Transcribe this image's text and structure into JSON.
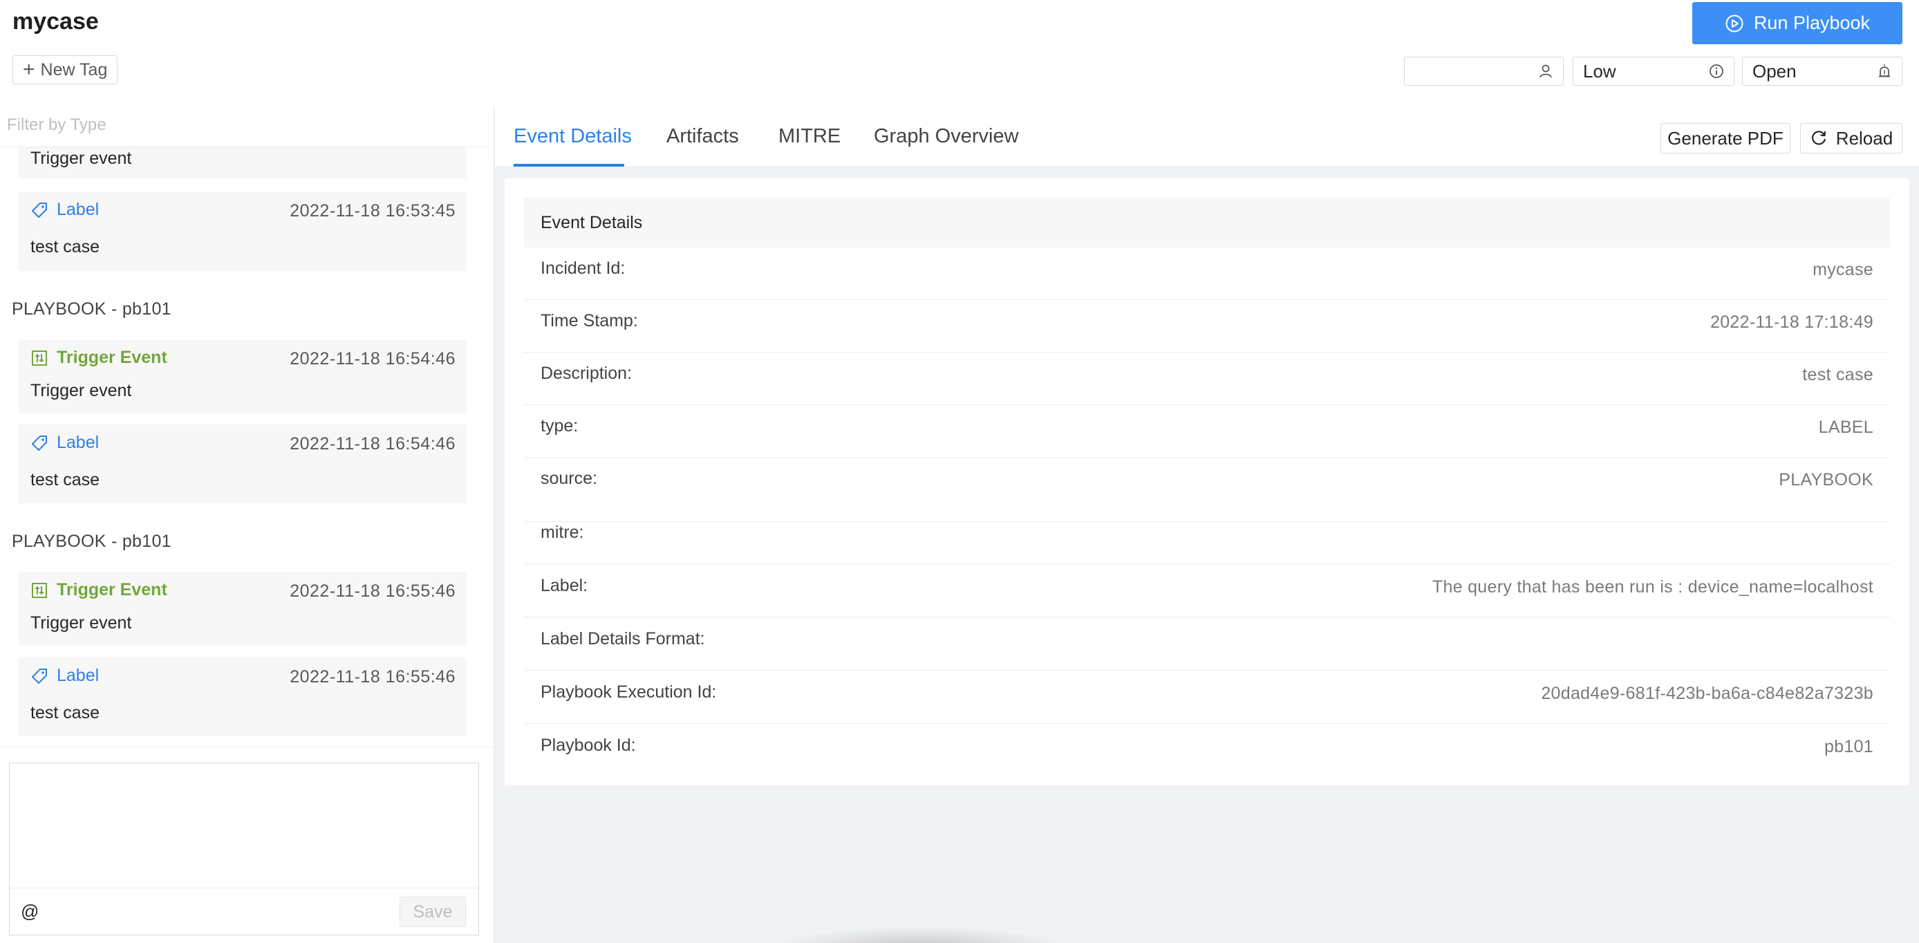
{
  "header": {
    "case_title": "mycase",
    "new_tag_label": "New Tag",
    "run_playbook_label": "Run Playbook",
    "assignee_value": "",
    "severity_value": "Low",
    "status_value": "Open"
  },
  "colors": {
    "accent": "#3d8ff5",
    "label_blue": "#2f80e6",
    "trigger_green": "#73a63c"
  },
  "timeline": {
    "filter_placeholder": "Filter by Type",
    "partial_card_desc": "Trigger event",
    "cards": [
      {
        "kind": "label",
        "title": "Label",
        "time": "2022-11-18 16:53:45",
        "desc": "test case",
        "icon": "tag-icon"
      }
    ],
    "groups": [
      {
        "title": "PLAYBOOK - pb101",
        "cards": [
          {
            "kind": "trigger",
            "title": "Trigger Event",
            "time": "2022-11-18 16:54:46",
            "desc": "Trigger event",
            "icon": "trigger-icon"
          },
          {
            "kind": "label",
            "title": "Label",
            "time": "2022-11-18 16:54:46",
            "desc": "test case",
            "icon": "tag-icon"
          }
        ]
      },
      {
        "title": "PLAYBOOK - pb101",
        "cards": [
          {
            "kind": "trigger",
            "title": "Trigger Event",
            "time": "2022-11-18 16:55:46",
            "desc": "Trigger event",
            "icon": "trigger-icon"
          },
          {
            "kind": "label",
            "title": "Label",
            "time": "2022-11-18 16:55:46",
            "desc": "test case",
            "icon": "tag-icon"
          }
        ]
      }
    ]
  },
  "comment": {
    "text": "",
    "mention_symbol": "@",
    "save_label": "Save"
  },
  "tabs": [
    "Event Details",
    "Artifacts",
    "MITRE",
    "Graph Overview"
  ],
  "actions": {
    "generate_pdf": "Generate PDF",
    "reload": "Reload"
  },
  "event_details": {
    "heading": "Event Details",
    "rows": [
      {
        "key": "Incident Id:",
        "value": "mycase"
      },
      {
        "key": "Time Stamp:",
        "value": "2022-11-18 17:18:49"
      },
      {
        "key": "Description:",
        "value": "test case"
      },
      {
        "key": "type:",
        "value": "LABEL"
      },
      {
        "key": "source:",
        "value": "PLAYBOOK"
      },
      {
        "key": "mitre:",
        "value": ""
      },
      {
        "key": "Label:",
        "value": "The query that has been run is : device_name=localhost"
      },
      {
        "key": "Label Details Format:",
        "value": ""
      },
      {
        "key": "Playbook Execution Id:",
        "value": "20dad4e9-681f-423b-ba6a-c84e82a7323b"
      },
      {
        "key": "Playbook Id:",
        "value": "pb101"
      }
    ]
  }
}
